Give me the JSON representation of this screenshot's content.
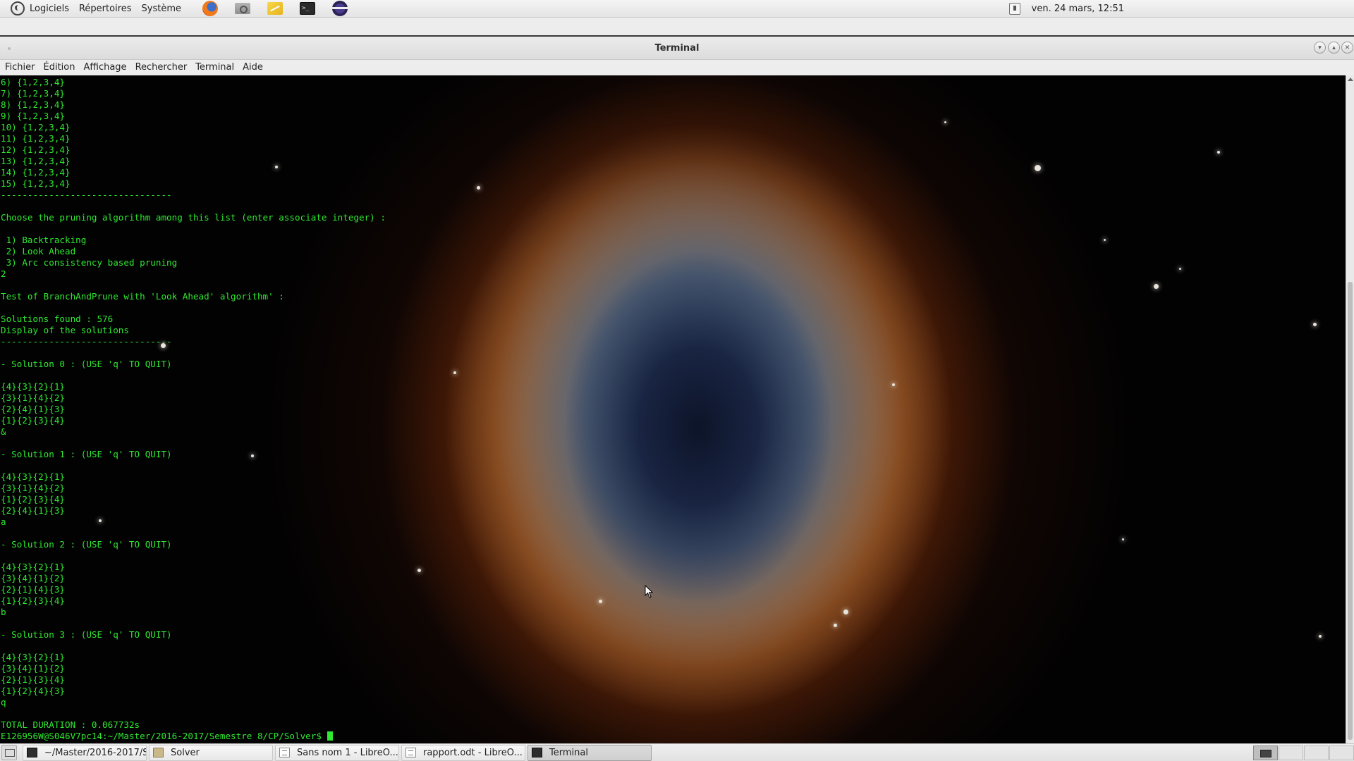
{
  "top_panel": {
    "menus": [
      "Logiciels",
      "Répertoires",
      "Système"
    ],
    "launchers": [
      "firefox-icon",
      "files-icon",
      "notes-icon",
      "terminal-icon",
      "eclipse-icon"
    ],
    "clock": "ven. 24 mars, 12:51"
  },
  "window": {
    "title": "Terminal",
    "menu": [
      "Fichier",
      "Édition",
      "Affichage",
      "Rechercher",
      "Terminal",
      "Aide"
    ]
  },
  "terminal": {
    "lines": [
      "6) {1,2,3,4}",
      "7) {1,2,3,4}",
      "8) {1,2,3,4}",
      "9) {1,2,3,4}",
      "10) {1,2,3,4}",
      "11) {1,2,3,4}",
      "12) {1,2,3,4}",
      "13) {1,2,3,4}",
      "14) {1,2,3,4}",
      "15) {1,2,3,4}",
      "--------------------------------",
      "",
      "Choose the pruning algorithm among this list (enter associate integer) :",
      "",
      " 1) Backtracking",
      " 2) Look Ahead",
      " 3) Arc consistency based pruning",
      "2",
      "",
      "Test of BranchAndPrune with 'Look Ahead' algorithm' :",
      "",
      "Solutions found : 576",
      "Display of the solutions",
      "--------------------------------",
      "",
      "- Solution 0 : (USE 'q' TO QUIT)",
      "",
      "{4}{3}{2}{1}",
      "{3}{1}{4}{2}",
      "{2}{4}{1}{3}",
      "{1}{2}{3}{4}",
      "&",
      "",
      "- Solution 1 : (USE 'q' TO QUIT)",
      "",
      "{4}{3}{2}{1}",
      "{3}{1}{4}{2}",
      "{1}{2}{3}{4}",
      "{2}{4}{1}{3}",
      "a",
      "",
      "- Solution 2 : (USE 'q' TO QUIT)",
      "",
      "{4}{3}{2}{1}",
      "{3}{4}{1}{2}",
      "{2}{1}{4}{3}",
      "{1}{2}{3}{4}",
      "b",
      "",
      "- Solution 3 : (USE 'q' TO QUIT)",
      "",
      "{4}{3}{2}{1}",
      "{3}{4}{1}{2}",
      "{2}{1}{3}{4}",
      "{1}{2}{4}{3}",
      "q",
      "",
      "TOTAL DURATION : 0.067732s"
    ],
    "prompt": "E126956W@S046V7pc14:~/Master/2016-2017/Semestre 8/CP/Solver$ "
  },
  "taskbar": {
    "tasks": [
      {
        "label": "~/Master/2016-2017/S...",
        "icon": "terminal-icon",
        "active": false
      },
      {
        "label": "Solver",
        "icon": "folder-icon",
        "active": false
      },
      {
        "label": "Sans nom 1 - LibreO...",
        "icon": "document-icon",
        "active": false
      },
      {
        "label": "rapport.odt - LibreO...",
        "icon": "document-icon",
        "active": false
      },
      {
        "label": "Terminal",
        "icon": "terminal-icon",
        "active": true
      }
    ],
    "workspace_count": 4
  },
  "colors": {
    "terminal_text": "#2fe82f",
    "panel_bg": "#ededed"
  }
}
